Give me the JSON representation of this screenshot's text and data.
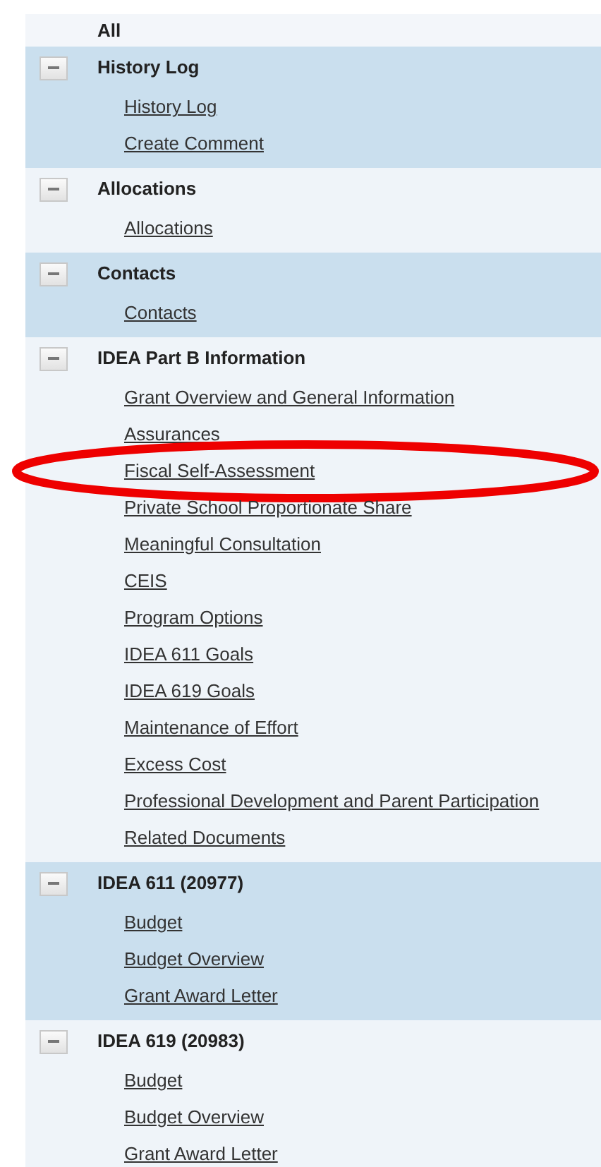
{
  "tree": {
    "root_label": "All",
    "groups": [
      {
        "title": "History Log",
        "expanded": true,
        "links": [
          {
            "label": "History Log",
            "circled": false
          },
          {
            "label": "Create Comment",
            "circled": false
          }
        ]
      },
      {
        "title": "Allocations",
        "expanded": true,
        "links": [
          {
            "label": "Allocations",
            "circled": false
          }
        ]
      },
      {
        "title": "Contacts",
        "expanded": true,
        "links": [
          {
            "label": "Contacts",
            "circled": false
          }
        ]
      },
      {
        "title": "IDEA Part B Information",
        "expanded": true,
        "links": [
          {
            "label": "Grant Overview and General Information",
            "circled": false
          },
          {
            "label": "Assurances",
            "circled": false
          },
          {
            "label": "Fiscal Self-Assessment",
            "circled": true
          },
          {
            "label": "Private School Proportionate Share",
            "circled": false
          },
          {
            "label": "Meaningful Consultation",
            "circled": false
          },
          {
            "label": "CEIS",
            "circled": false
          },
          {
            "label": "Program Options",
            "circled": false
          },
          {
            "label": "IDEA 611 Goals",
            "circled": false
          },
          {
            "label": "IDEA 619 Goals",
            "circled": false
          },
          {
            "label": "Maintenance of Effort",
            "circled": false
          },
          {
            "label": "Excess Cost",
            "circled": false
          },
          {
            "label": "Professional Development and Parent Participation",
            "circled": false
          },
          {
            "label": "Related Documents",
            "circled": false
          }
        ]
      },
      {
        "title": "IDEA 611 (20977)",
        "expanded": true,
        "links": [
          {
            "label": "Budget",
            "circled": false
          },
          {
            "label": "Budget Overview",
            "circled": false
          },
          {
            "label": "Grant Award Letter",
            "circled": false
          }
        ]
      },
      {
        "title": "IDEA 619 (20983)",
        "expanded": true,
        "links": [
          {
            "label": "Budget",
            "circled": false
          },
          {
            "label": "Budget Overview",
            "circled": false
          },
          {
            "label": "Grant Award Letter",
            "circled": false
          }
        ]
      }
    ]
  }
}
